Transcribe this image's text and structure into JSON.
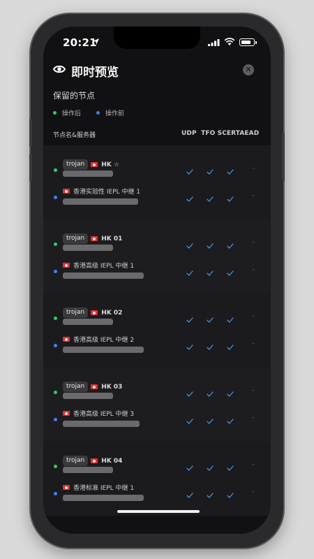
{
  "status_bar": {
    "time": "20:21"
  },
  "header": {
    "title": "即时预览",
    "close_symbol": "✕"
  },
  "section": {
    "title": "保留的节点"
  },
  "legend": [
    {
      "label": "操作后",
      "color": "#2ecc71"
    },
    {
      "label": "操作前",
      "color": "#3b82f6"
    }
  ],
  "columns": {
    "name": "节点名&服务器",
    "flags": "UDP  TFO SCERTAEAD"
  },
  "colors": {
    "after": "#2ecc71",
    "before": "#3b82f6",
    "check": "#4a90e2"
  },
  "groups": [
    {
      "after": {
        "tag": "trojan",
        "name": "HK ☆",
        "checks": [
          true,
          true,
          true
        ],
        "dash": "–"
      },
      "before": {
        "name": "香港实验性 IEPL 中继 1",
        "checks": [
          true,
          true,
          true
        ],
        "dash": "–"
      }
    },
    {
      "after": {
        "tag": "trojan",
        "name": "HK 01",
        "checks": [
          true,
          true,
          true
        ],
        "dash": "–"
      },
      "before": {
        "name": "香港高级 IEPL 中继 1",
        "checks": [
          true,
          true,
          true
        ],
        "dash": "–"
      }
    },
    {
      "after": {
        "tag": "trojan",
        "name": "HK 02",
        "checks": [
          true,
          true,
          true
        ],
        "dash": "–"
      },
      "before": {
        "name": "香港高级 IEPL 中继 2",
        "checks": [
          true,
          true,
          true
        ],
        "dash": "–"
      }
    },
    {
      "after": {
        "tag": "trojan",
        "name": "HK 03",
        "checks": [
          true,
          true,
          true
        ],
        "dash": "–"
      },
      "before": {
        "name": "香港高级 IEPL 中继 3",
        "checks": [
          true,
          true,
          true
        ],
        "dash": "–"
      }
    },
    {
      "after": {
        "tag": "trojan",
        "name": "HK 04",
        "checks": [
          true,
          true,
          true
        ],
        "dash": "–"
      },
      "before": {
        "name": "香港标准 IEPL 中继 1",
        "checks": [
          true,
          true,
          true
        ],
        "dash": "–"
      }
    }
  ]
}
